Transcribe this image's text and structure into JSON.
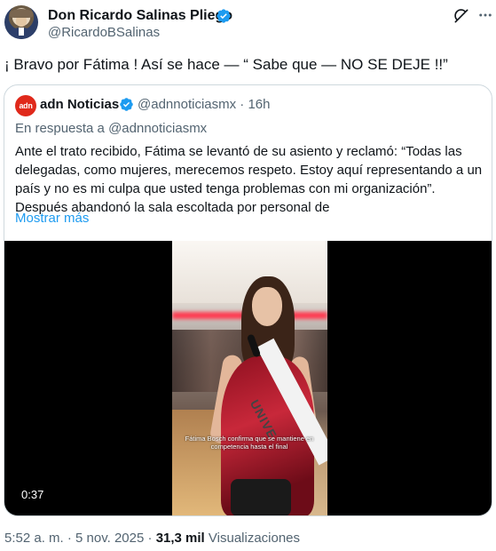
{
  "author": {
    "display_name": "Don Ricardo Salinas Pliego",
    "handle": "@RicardoBSalinas"
  },
  "icons": {
    "verified": "verified-badge-icon",
    "grok": "grok-icon",
    "more": "more-icon"
  },
  "colors": {
    "verified_blue": "#1d9bf0",
    "link_blue": "#1d9bf0",
    "secondary_text": "#536471",
    "adn_brand_red": "#e0291b"
  },
  "tweet": {
    "text": "¡ Bravo por Fátima ! Así se hace — “ Sabe que — NO SE DEJE !!”"
  },
  "quote": {
    "logo_text": "adn",
    "display_name": "adn Noticias",
    "handle": "@adnnoticiasmx",
    "separator": "·",
    "time": "16h",
    "reply_prefix": "En respuesta a",
    "reply_to": "@adnnoticiasmx",
    "body": "Ante el trato recibido, Fátima se levantó de su asiento y reclamó: “Todas las delegadas, como mujeres, merecemos respeto. Estoy aquí representando a un país y no es mi culpa que usted tenga problemas con mi organización”. Después abandonó la sala escoltada por personal de",
    "show_more": "Mostrar más",
    "video": {
      "duration": "0:37",
      "sash_text": "UNIVE",
      "caption": "Fátima Bosch confirma que se mantiene en competencia hasta el final"
    }
  },
  "meta": {
    "time": "5:52 a. m.",
    "separator1": "·",
    "date": "5 nov. 2025",
    "separator2": "·",
    "views_count": "31,3 mil",
    "views_label": "Visualizaciones"
  }
}
